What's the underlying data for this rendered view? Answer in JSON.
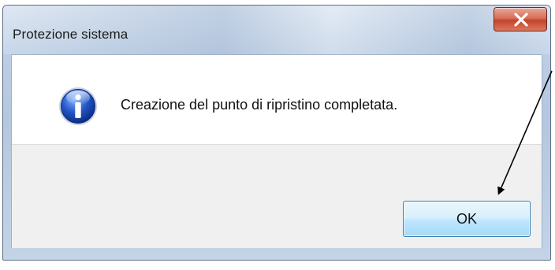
{
  "dialog": {
    "title": "Protezione sistema",
    "message": "Creazione del punto di ripristino completata.",
    "ok_label": "OK",
    "close_icon": "close-icon",
    "info_icon": "info-icon"
  },
  "annotation": {
    "type": "arrow",
    "color": "#000000"
  }
}
